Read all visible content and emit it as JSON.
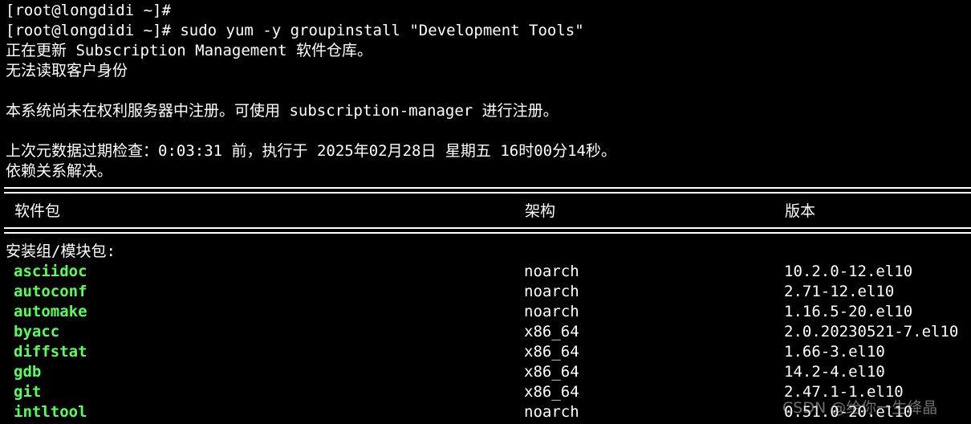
{
  "terminal": {
    "lines": [
      "[root@longdidi ~]#",
      "[root@longdidi ~]# sudo yum -y groupinstall \"Development Tools\"",
      "正在更新 Subscription Management 软件仓库。",
      "无法读取客户身份",
      "",
      "本系统尚未在权利服务器中注册。可使用 subscription-manager 进行注册。",
      "",
      "上次元数据过期检查：0:03:31 前，执行于 2025年02月28日 星期五 16时00分14秒。",
      "依赖关系解决。"
    ],
    "table_header": {
      "name": "软件包",
      "arch": "架构",
      "version": "版本"
    },
    "group_label": "安装组/模块包:",
    "packages": [
      {
        "name": "asciidoc",
        "arch": "noarch",
        "version": "10.2.0-12.el10"
      },
      {
        "name": "autoconf",
        "arch": "noarch",
        "version": "2.71-12.el10"
      },
      {
        "name": "automake",
        "arch": "noarch",
        "version": "1.16.5-20.el10"
      },
      {
        "name": "byacc",
        "arch": "x86_64",
        "version": "2.0.20230521-7.el10"
      },
      {
        "name": "diffstat",
        "arch": "x86_64",
        "version": "1.66-3.el10"
      },
      {
        "name": "gdb",
        "arch": "x86_64",
        "version": "14.2-4.el10"
      },
      {
        "name": "git",
        "arch": "x86_64",
        "version": "2.47.1-1.el10"
      },
      {
        "name": "intltool",
        "arch": "noarch",
        "version": "0.51.0-20.el10"
      }
    ],
    "watermark": "CSDN @给你一生绛晶"
  },
  "colors": {
    "background": "#000000",
    "text": "#ffffff",
    "package_name": "#55ff55"
  }
}
